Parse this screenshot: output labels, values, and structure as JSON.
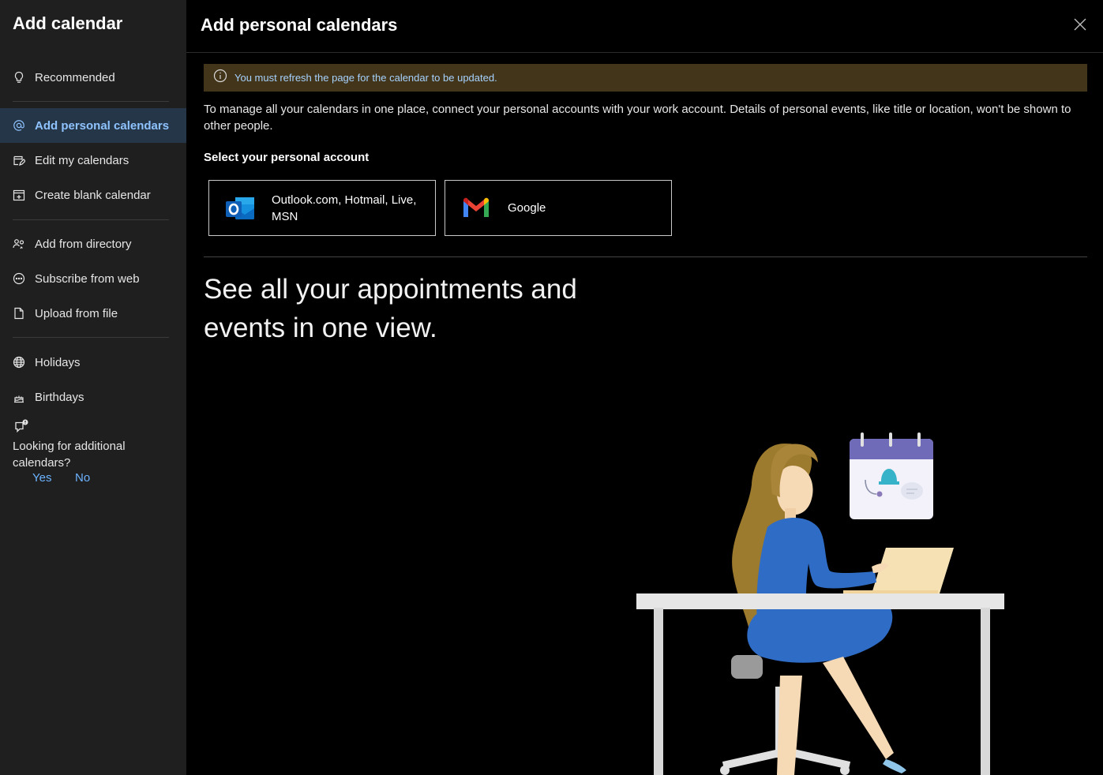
{
  "sidebar": {
    "title": "Add calendar",
    "items": [
      {
        "label": "Recommended",
        "icon": "lightbulb-icon"
      },
      {
        "label": "Add personal calendars",
        "icon": "at-sign-icon",
        "active": true
      },
      {
        "label": "Edit my calendars",
        "icon": "edit-calendar-icon"
      },
      {
        "label": "Create blank calendar",
        "icon": "add-calendar-icon"
      },
      {
        "label": "Add from directory",
        "icon": "people-search-icon"
      },
      {
        "label": "Subscribe from web",
        "icon": "globe-link-icon"
      },
      {
        "label": "Upload from file",
        "icon": "document-icon"
      },
      {
        "label": "Holidays",
        "icon": "globe-icon"
      },
      {
        "label": "Birthdays",
        "icon": "cake-icon"
      }
    ],
    "feedback": {
      "question": "Looking for additional calendars?",
      "yes": "Yes",
      "no": "No"
    }
  },
  "main": {
    "title": "Add personal calendars",
    "banner": "You must refresh the page for the calendar to be updated.",
    "description": "To manage all your calendars in one place, connect your personal accounts with your work account. Details of personal events, like title or location, won't be shown to other people.",
    "select_label": "Select your personal account",
    "accounts": [
      {
        "label": "Outlook.com, Hotmail, Live, MSN",
        "icon": "outlook-logo-icon"
      },
      {
        "label": "Google",
        "icon": "gmail-logo-icon"
      }
    ],
    "hero_text": "See all your appointments and events in one view."
  },
  "colors": {
    "sidebar_bg": "#1f1f1f",
    "active_bg": "#253648",
    "active_text": "#8fc3ff",
    "banner_bg": "#433519",
    "banner_text": "#a6d2ff",
    "link": "#6cb3ff"
  }
}
